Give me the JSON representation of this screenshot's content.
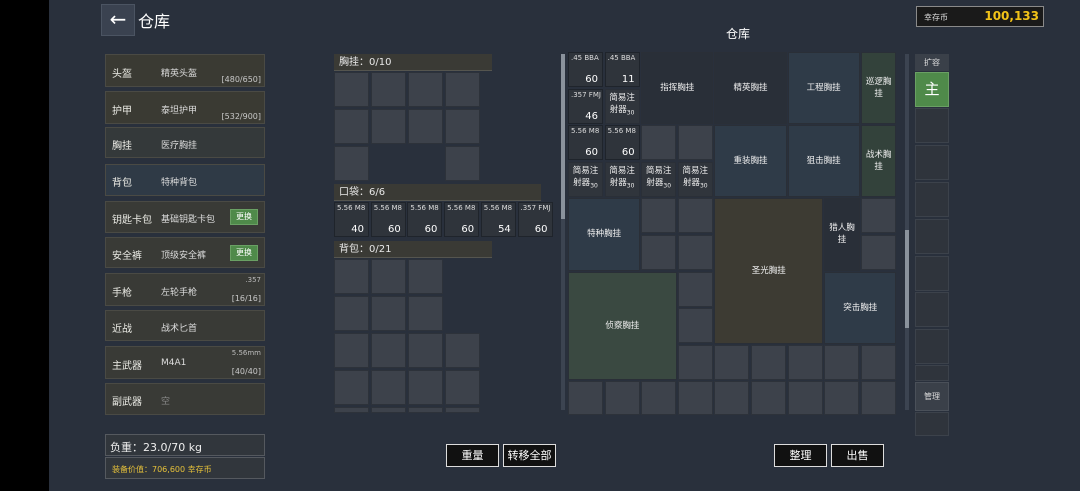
{
  "header": {
    "title": "仓库",
    "back_icon": "←",
    "stash_title": "仓库",
    "coin_label": "幸存币",
    "coin_value": "100,133"
  },
  "equipment": [
    {
      "slot": "头盔",
      "item": "精英头盔",
      "durability": "[480/650]"
    },
    {
      "slot": "护甲",
      "item": "泰坦护甲",
      "durability": "[532/900]"
    },
    {
      "slot": "胸挂",
      "item": "医疗胸挂"
    },
    {
      "slot": "背包",
      "item": "特种背包"
    },
    {
      "slot": "钥匙卡包",
      "item": "基础钥匙卡包",
      "action": "更换"
    },
    {
      "slot": "安全裤",
      "item": "顶级安全裤",
      "action": "更换"
    },
    {
      "slot": "手枪",
      "item": "左轮手枪",
      "caliber": ".357",
      "ammo": "[16/16]"
    },
    {
      "slot": "近战",
      "item": "战术匕首"
    },
    {
      "slot": "主武器",
      "item": "M4A1",
      "caliber": "5.56mm",
      "ammo": "[40/40]"
    },
    {
      "slot": "副武器",
      "item": "空"
    }
  ],
  "summary": {
    "weight": "负重：23.0/70 kg",
    "value_label": "装备价值：",
    "value": "706,600",
    "value_unit": "幸存币"
  },
  "containers": {
    "rig": {
      "title": "胸挂：0/10"
    },
    "pockets": {
      "title": "口袋：6/6",
      "items": [
        {
          "name": "5.56 M8",
          "qty": "40"
        },
        {
          "name": "5.56 M8",
          "qty": "60"
        },
        {
          "name": "5.56 M8",
          "qty": "60"
        },
        {
          "name": "5.56 M8",
          "qty": "60"
        },
        {
          "name": "5.56 M8",
          "qty": "54"
        },
        {
          "name": ".357 FMJ",
          "qty": "60"
        }
      ]
    },
    "backpack": {
      "title": "背包：0/21"
    }
  },
  "buttons": {
    "weight": "重量",
    "transfer_all": "转移全部",
    "sort": "整理",
    "sell": "出售"
  },
  "stash": {
    "ammo": [
      {
        "name": ".45 BBA",
        "qty": "60"
      },
      {
        "name": ".45 BBA",
        "qty": "11"
      },
      {
        "name": ".357 FMJ",
        "qty": "46"
      },
      {
        "name": "5.56 M8",
        "qty": "60"
      },
      {
        "name": "5.56 M8",
        "qty": "60"
      }
    ],
    "injector_line1": "简易注",
    "injector_line2": "射器",
    "injector_sub": "30",
    "rigs": [
      "指挥胸挂",
      "精英胸挂",
      "工程胸挂",
      "巡逻胸挂",
      "重装胸挂",
      "狙击胸挂",
      "战术胸挂",
      "特种胸挂",
      "猎人胸挂",
      "圣光胸挂",
      "侦察胸挂",
      "突击胸挂"
    ]
  },
  "rightbar": {
    "expand": "扩容",
    "main": "主",
    "manage": "管理"
  },
  "colors": {
    "coin": "#f2c318",
    "value": "#e7c23a",
    "change_button": "#4f8a4a",
    "main_tab": "#4f8a4a"
  }
}
